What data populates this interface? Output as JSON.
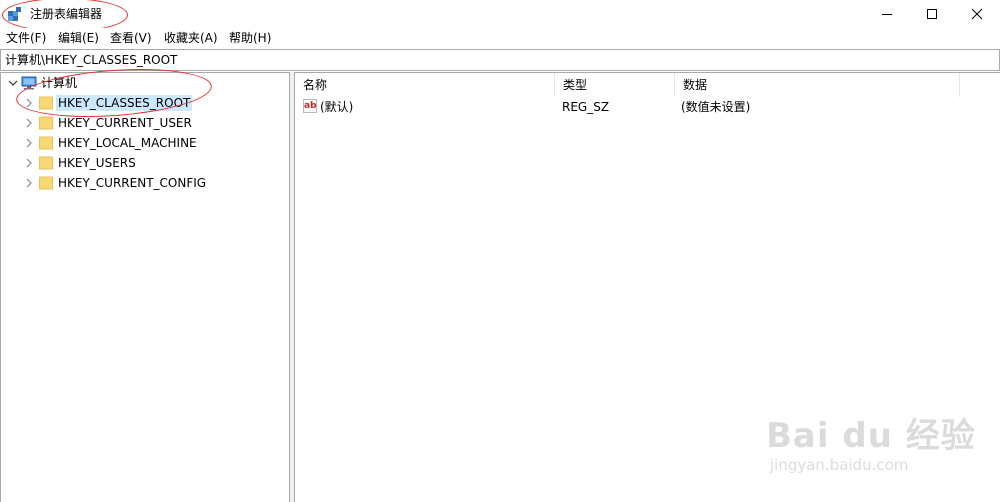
{
  "window": {
    "title": "注册表编辑器",
    "controls": {
      "minimize_icon": "minimize-icon",
      "maximize_icon": "maximize-icon",
      "close_icon": "close-icon"
    }
  },
  "menu": [
    "文件(F)",
    "编辑(E)",
    "查看(V)",
    "收藏夹(A)",
    "帮助(H)"
  ],
  "address": "计算机\\HKEY_CLASSES_ROOT",
  "tree": {
    "root": "计算机",
    "items": [
      "HKEY_CLASSES_ROOT",
      "HKEY_CURRENT_USER",
      "HKEY_LOCAL_MACHINE",
      "HKEY_USERS",
      "HKEY_CURRENT_CONFIG"
    ],
    "selected": "HKEY_CLASSES_ROOT"
  },
  "list": {
    "columns": [
      "名称",
      "类型",
      "数据"
    ],
    "rows": [
      {
        "name": "(默认)",
        "type": "REG_SZ",
        "data": "(数值未设置)",
        "icon": "ab-icon"
      }
    ]
  },
  "watermark": {
    "brand": "Bai du 经验",
    "url": "jingyan.baidu.com"
  },
  "colors": {
    "selection": "#cce8ff",
    "annotation_red": "#e03030",
    "folder": "#f8d775"
  }
}
